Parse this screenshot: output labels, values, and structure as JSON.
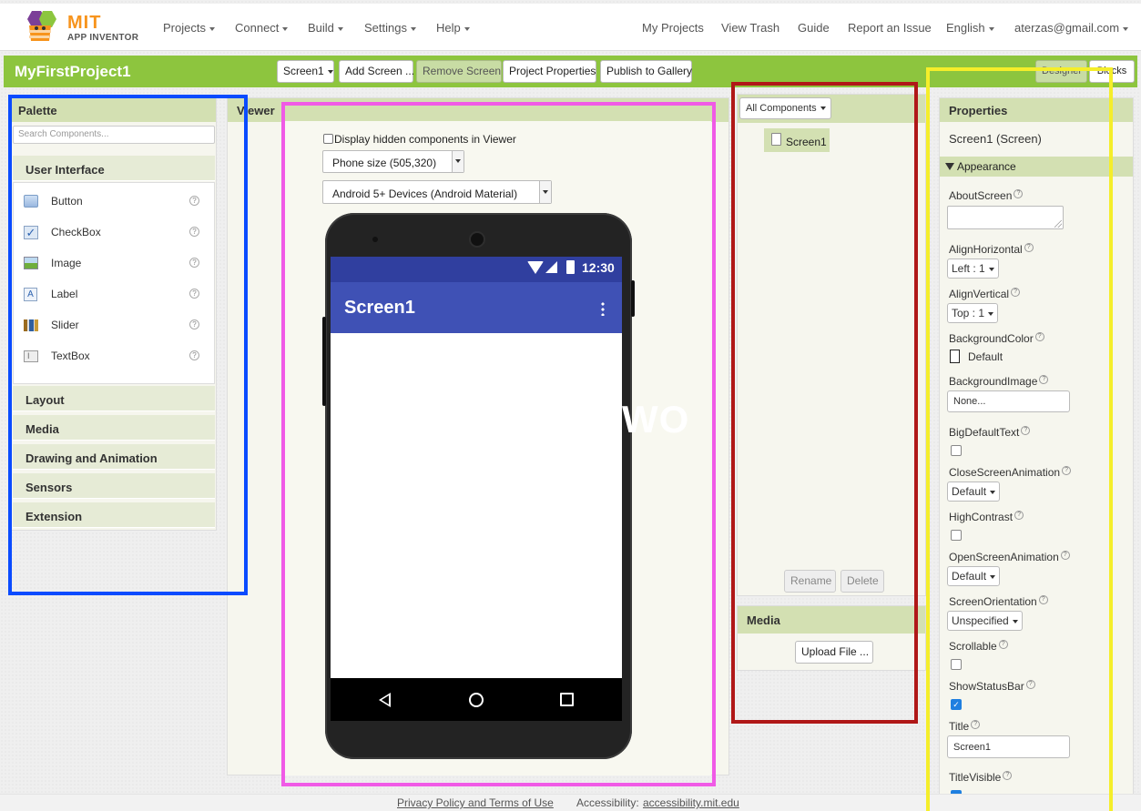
{
  "brand": {
    "line1": "MIT",
    "line2": "APP INVENTOR"
  },
  "nav": {
    "left": [
      "Projects",
      "Connect",
      "Build",
      "Settings",
      "Help"
    ],
    "right": [
      "My Projects",
      "View Trash",
      "Guide",
      "Report an Issue",
      "English",
      "aterzas@gmail.com"
    ]
  },
  "project": {
    "name": "MyFirstProject1",
    "buttons": {
      "screen": "Screen1",
      "add_screen": "Add Screen ...",
      "remove_screen": "Remove Screen",
      "properties": "Project Properties",
      "publish": "Publish to Gallery"
    },
    "modes": {
      "designer": "Designer",
      "blocks": "Blocks"
    }
  },
  "palette": {
    "title": "Palette",
    "search_placeholder": "Search Components...",
    "open_category": "User Interface",
    "items": [
      "Button",
      "CheckBox",
      "Image",
      "Label",
      "Slider",
      "TextBox"
    ],
    "help": "?",
    "categories": [
      "Layout",
      "Media",
      "Drawing and Animation",
      "Sensors",
      "Extension"
    ]
  },
  "viewer": {
    "title": "Viewer",
    "hidden_checkbox": "Display hidden components in Viewer",
    "size_select": "Phone size (505,320)",
    "theme_select": "Android 5+ Devices (Android Material)",
    "phone": {
      "time": "12:30",
      "screen_title": "Screen1",
      "watermark": "WO"
    }
  },
  "components": {
    "selector": "All Components",
    "tree": [
      "Screen1"
    ],
    "rename": "Rename",
    "delete": "Delete"
  },
  "media": {
    "title": "Media",
    "upload": "Upload File ..."
  },
  "properties": {
    "title": "Properties",
    "subject": "Screen1 (Screen)",
    "section": "Appearance",
    "labels": {
      "about": "AboutScreen",
      "align_h": "AlignHorizontal",
      "align_v": "AlignVertical",
      "bg_color": "BackgroundColor",
      "bg_image": "BackgroundImage",
      "big_text": "BigDefaultText",
      "close_anim": "CloseScreenAnimation",
      "high_contrast": "HighContrast",
      "open_anim": "OpenScreenAnimation",
      "orientation": "ScreenOrientation",
      "scrollable": "Scrollable",
      "status_bar": "ShowStatusBar",
      "title": "Title",
      "title_visible": "TitleVisible"
    },
    "values": {
      "align_h": "Left : 1",
      "align_v": "Top : 1",
      "bg_color": "Default",
      "bg_image": "None...",
      "close_anim": "Default",
      "open_anim": "Default",
      "orientation": "Unspecified",
      "title": "Screen1"
    },
    "checks": {
      "big_text": false,
      "high_contrast": false,
      "scrollable": false,
      "status_bar": true,
      "title_visible": true
    }
  },
  "footer": {
    "privacy": "Privacy Policy and Terms of Use",
    "accessibility_label": "Accessibility:",
    "accessibility_link": "accessibility.mit.edu"
  },
  "colors": {
    "green": "#8dc53e",
    "android_blue": "#3f51b5",
    "status_blue": "#303f9f",
    "highlight_blue": "#0a4bff",
    "highlight_magenta": "#f05ae6",
    "highlight_red": "#b01818",
    "highlight_yellow": "#f5ee2a"
  }
}
